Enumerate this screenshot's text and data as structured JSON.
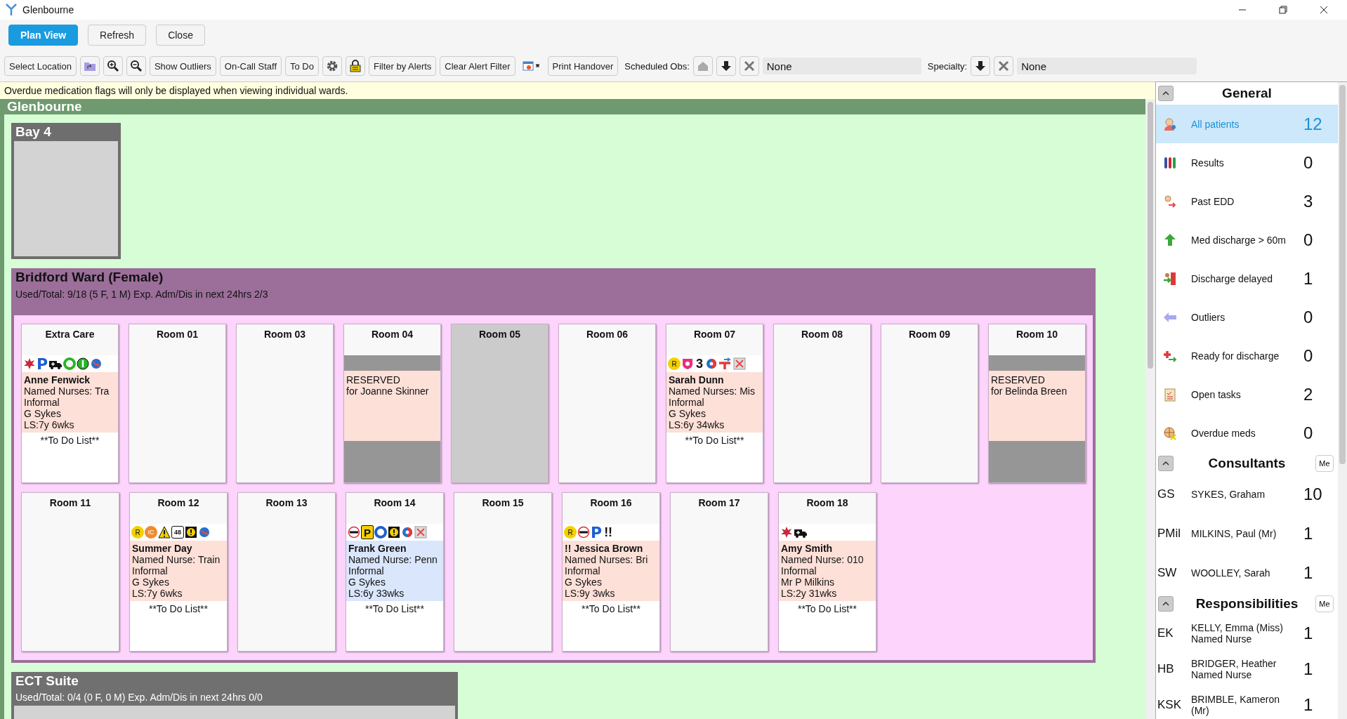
{
  "window": {
    "title": "Glenbourne"
  },
  "actions": [
    {
      "label": "Plan View",
      "selected": true
    },
    {
      "label": "Refresh",
      "selected": false
    },
    {
      "label": "Close",
      "selected": false
    }
  ],
  "toolbar": [
    {
      "kind": "button",
      "label": "Select Location"
    },
    {
      "kind": "folder"
    },
    {
      "kind": "zoom-in"
    },
    {
      "kind": "zoom-out"
    },
    {
      "kind": "button",
      "label": "Show Outliers"
    },
    {
      "kind": "button",
      "label": "On-Call Staff"
    },
    {
      "kind": "button",
      "label": "To Do"
    },
    {
      "kind": "gear"
    },
    {
      "kind": "lock"
    },
    {
      "kind": "button",
      "label": "Filter by Alerts"
    },
    {
      "kind": "button",
      "label": "Clear Alert Filter"
    },
    {
      "kind": "chart-menu"
    },
    {
      "kind": "button",
      "label": "Print Handover"
    },
    {
      "kind": "label",
      "label": "Scheduled Obs:"
    },
    {
      "kind": "home"
    },
    {
      "kind": "down"
    },
    {
      "kind": "clear"
    },
    {
      "kind": "field",
      "value": "None"
    },
    {
      "kind": "label",
      "label": "Specialty:"
    },
    {
      "kind": "down"
    },
    {
      "kind": "clear"
    },
    {
      "kind": "field",
      "value": "None"
    }
  ],
  "notice": "Overdue medication flags will only be displayed when viewing individual wards.",
  "site": {
    "title": "Glenbourne",
    "bay": {
      "title": "Bay 4"
    },
    "ward": {
      "title": "Bridford Ward (Female)",
      "summary": "Used/Total: 9/18 (5 F, 1 M) Exp. Adm/Dis in next 24hrs 2/3",
      "rows": [
        [
          {
            "room": "Extra Care",
            "kind": "patient",
            "color": "#fde0d8",
            "flags": [
              {
                "kind": "splat"
              },
              {
                "kind": "parking",
                "text": "P"
              },
              {
                "kind": "ambulance"
              },
              {
                "kind": "ring"
              },
              {
                "kind": "info"
              },
              {
                "kind": "globe"
              }
            ],
            "name": "Anne Fenwick",
            "lines": [
              "Named Nurses: Tra",
              "Informal",
              "G Sykes",
              "LS:7y 6wks"
            ],
            "todo": "**To Do List**"
          },
          {
            "room": "Room 01",
            "kind": "empty"
          },
          {
            "room": "Room 03",
            "kind": "empty"
          },
          {
            "room": "Room 04",
            "kind": "reserved",
            "lines": [
              "RESERVED",
              "for Joanne Skinner"
            ]
          },
          {
            "room": "Room 05",
            "kind": "closed"
          },
          {
            "room": "Room 06",
            "kind": "empty"
          },
          {
            "room": "Room 07",
            "kind": "patient",
            "color": "#fde0d8",
            "flags": [
              {
                "kind": "r-badge",
                "text": "R"
              },
              {
                "kind": "shield"
              },
              {
                "kind": "number",
                "text": "3"
              },
              {
                "kind": "split"
              },
              {
                "kind": "transfer"
              },
              {
                "kind": "cross"
              }
            ],
            "name": "Sarah Dunn",
            "lines": [
              "Named Nurses: Mis",
              "Informal",
              "G Sykes",
              "LS:6y 34wks"
            ],
            "todo": "**To Do List**"
          },
          {
            "room": "Room 08",
            "kind": "empty"
          },
          {
            "room": "Room 09",
            "kind": "empty"
          },
          {
            "room": "Room 10",
            "kind": "reserved",
            "lines": [
              "RESERVED",
              "for Belinda Breen"
            ]
          }
        ],
        [
          {
            "room": "Room 11",
            "kind": "empty"
          },
          {
            "room": "Room 12",
            "kind": "patient",
            "color": "#fde0d8",
            "flags": [
              {
                "kind": "r-badge",
                "text": "R"
              },
              {
                "kind": "ic-badge",
                "text": "IC"
              },
              {
                "kind": "warning"
              },
              {
                "kind": "hours",
                "text": "48"
              },
              {
                "kind": "alert"
              },
              {
                "kind": "globe"
              }
            ],
            "name": "Summer Day",
            "lines": [
              "Named Nurse: Train",
              "Informal",
              "G Sykes",
              "LS:7y 6wks"
            ],
            "todo": "**To Do List**"
          },
          {
            "room": "Room 13",
            "kind": "empty"
          },
          {
            "room": "Room 14",
            "kind": "patient",
            "color": "#dae6fb",
            "flags": [
              {
                "kind": "no-sign"
              },
              {
                "kind": "parking-yellow",
                "text": "P"
              },
              {
                "kind": "ring-blue"
              },
              {
                "kind": "alert"
              },
              {
                "kind": "split"
              },
              {
                "kind": "cross"
              }
            ],
            "name": "Frank Green",
            "lines": [
              "Named Nurse: Penn",
              "Informal",
              "G Sykes",
              "LS:6y 33wks"
            ],
            "todo": "**To Do List**"
          },
          {
            "room": "Room 15",
            "kind": "empty"
          },
          {
            "room": "Room 16",
            "kind": "patient",
            "color": "#fde0d8",
            "flags": [
              {
                "kind": "r-badge",
                "text": "R"
              },
              {
                "kind": "no-sign"
              },
              {
                "kind": "parking",
                "text": "P"
              },
              {
                "kind": "number",
                "text": "!!"
              }
            ],
            "name": "!! Jessica Brown",
            "lines": [
              "Named Nurses: Bri",
              "Informal",
              "G Sykes",
              "LS:9y 3wks"
            ],
            "todo": "**To Do List**"
          },
          {
            "room": "Room 17",
            "kind": "empty"
          },
          {
            "room": "Room 18",
            "kind": "patient",
            "color": "#fde0d8",
            "flags": [
              {
                "kind": "splat"
              },
              {
                "kind": "ambulance"
              }
            ],
            "name": "Amy Smith",
            "lines": [
              "Named Nurse: 010",
              "Informal",
              "Mr P Milkins",
              "LS:2y 31wks"
            ],
            "todo": "**To Do List**"
          }
        ]
      ]
    },
    "suite": {
      "title": "ECT Suite",
      "summary": "Used/Total: 0/4 (0 F, 0 M) Exp. Adm/Dis in next 24hrs 0/0"
    }
  },
  "sidebar": {
    "general": {
      "title": "General",
      "items": [
        {
          "kind": "patient",
          "label": "All patients",
          "count": "12",
          "selected": true
        },
        {
          "kind": "tubes",
          "label": "Results",
          "count": "0",
          "selected": false
        },
        {
          "kind": "edd",
          "label": "Past EDD",
          "count": "3",
          "selected": false
        },
        {
          "kind": "up",
          "label": "Med discharge > 60m",
          "count": "0",
          "selected": false
        },
        {
          "kind": "delayed",
          "label": "Discharge delayed",
          "count": "1",
          "selected": false
        },
        {
          "kind": "left",
          "label": "Outliers",
          "count": "0",
          "selected": false
        },
        {
          "kind": "ready",
          "label": "Ready for discharge",
          "count": "0",
          "selected": false
        },
        {
          "kind": "clipboard",
          "label": "Open tasks",
          "count": "2",
          "selected": false
        },
        {
          "kind": "meds",
          "label": "Overdue meds",
          "count": "0",
          "selected": false
        }
      ]
    },
    "consultants": {
      "title": "Consultants",
      "me": "Me",
      "items": [
        {
          "initials": "GS",
          "name": "SYKES, Graham",
          "count": "10"
        },
        {
          "initials": "PMil",
          "name": "MILKINS, Paul (Mr)",
          "count": "1"
        },
        {
          "initials": "SW",
          "name": "WOOLLEY, Sarah",
          "count": "1"
        }
      ]
    },
    "responsibilities": {
      "title": "Responsibilities",
      "me": "Me",
      "items": [
        {
          "initials": "EK",
          "name": "KELLY, Emma (Miss)",
          "role": "Named Nurse",
          "count": "1"
        },
        {
          "initials": "HB",
          "name": "BRIDGER, Heather",
          "role": "Named Nurse",
          "count": "1"
        },
        {
          "initials": "KSK",
          "name": "BRIMBLE, Kameron (Mr)",
          "count": "1"
        }
      ]
    }
  }
}
